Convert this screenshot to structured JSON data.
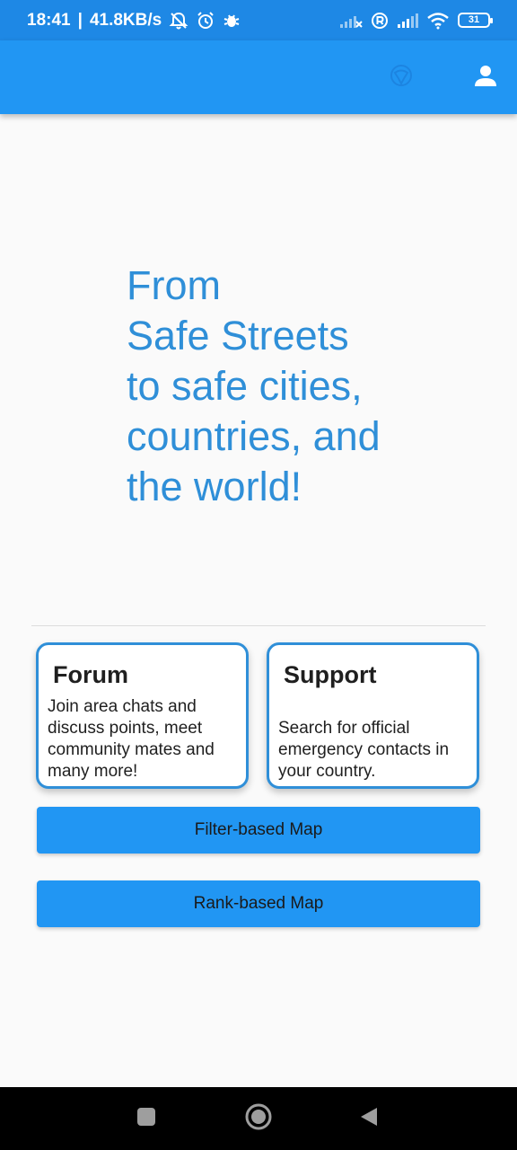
{
  "status_bar": {
    "time": "18:41",
    "separator": "|",
    "network_speed": "41.8KB/s",
    "battery_level": "31",
    "icons": [
      "notifications-off-icon",
      "alarm-icon",
      "bug-icon",
      "signal-no-sim-icon",
      "roaming-r-icon",
      "signal-bars-icon",
      "wifi-icon",
      "battery-icon"
    ]
  },
  "app_bar": {
    "color": "#2196f3",
    "icons": [
      "app-logo-icon",
      "account-icon"
    ]
  },
  "hero": {
    "lines": [
      "From",
      "Safe Streets",
      "to safe cities,",
      "countries, and",
      "the world!"
    ],
    "color": "#2f8fd8"
  },
  "cards": {
    "forum": {
      "title": "Forum",
      "description": "Join area chats and discuss points, meet community mates and many more!"
    },
    "support": {
      "title": "Support",
      "description": "Search for official emergency contacts in your country."
    },
    "border_color": "#2f8fd8"
  },
  "buttons": {
    "filter_map": "Filter-based Map",
    "rank_map": "Rank-based Map"
  },
  "nav_bar": {
    "icons": [
      "recents-square-icon",
      "home-circle-icon",
      "back-triangle-icon"
    ]
  }
}
